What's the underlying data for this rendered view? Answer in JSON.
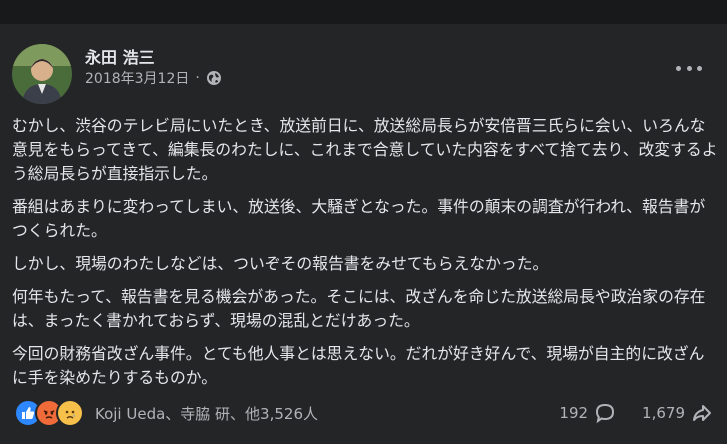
{
  "post": {
    "author": "永田 浩三",
    "date": "2018年3月12日",
    "separator": "·",
    "privacy_icon": "globe-icon",
    "paragraphs": [
      "むかし、渋谷のテレビ局にいたとき、放送前日に、放送総局長らが安倍晋三氏らに会い、いろんな意見をもらってきて、編集長のわたしに、これまで合意していた内容をすべて捨て去り、改変するよう総局長らが直接指示した。",
      "番組はあまりに変わってしまい、放送後、大騒ぎとなった。事件の顛末の調査が行われ、報告書がつくられた。",
      "しかし、現場のわたしなどは、ついぞその報告書をみせてもらえなかった。",
      "何年もたって、報告書を見る機会があった。そこには、改ざんを命じた放送総局長や政治家の存在は、まったく書かれておらず、現場の混乱とだけあった。",
      "今回の財務省改ざん事件。とても他人事とは思えない。だれが好き好んで、現場が自主的に改ざんに手を染めたりするものか。"
    ]
  },
  "footer": {
    "reaction_icons": [
      "like-icon",
      "angry-icon",
      "sad-icon"
    ],
    "reaction_names": "Koji Ueda、寺脇 研、他3,526人",
    "comment_count": "192",
    "share_count": "1,679"
  },
  "colors": {
    "card_bg": "#242526",
    "page_bg": "#18191a",
    "text_primary": "#e4e6eb",
    "text_secondary": "#b0b3b8",
    "like_blue": "#2d88ff",
    "angry_orange": "#f06b3a",
    "sad_yellow": "#f7c04a"
  }
}
